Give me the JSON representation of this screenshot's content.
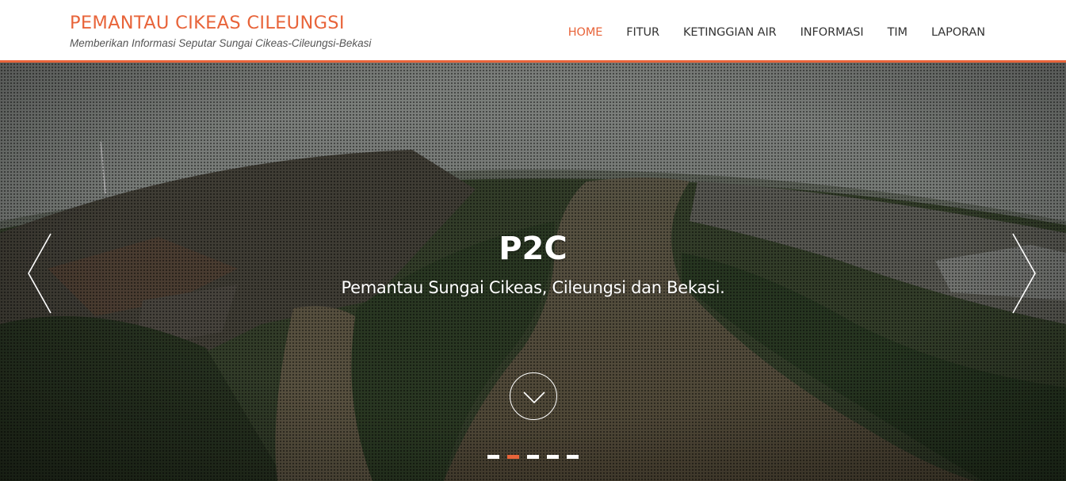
{
  "header": {
    "brand_title": "PEMANTAU CIKEAS CILEUNGSI",
    "brand_tagline": "Memberikan Informasi Seputar Sungai Cikeas-Cileungsi-Bekasi"
  },
  "nav": {
    "items": [
      {
        "label": "HOME",
        "active": true
      },
      {
        "label": "FITUR",
        "active": false
      },
      {
        "label": "KETINGGIAN AIR",
        "active": false
      },
      {
        "label": "INFORMASI",
        "active": false
      },
      {
        "label": "TIM",
        "active": false
      },
      {
        "label": "LAPORAN",
        "active": false
      }
    ]
  },
  "hero": {
    "title": "P2C",
    "subtitle": "Pemantau Sungai Cikeas, Cileungsi dan Bekasi.",
    "prev_icon": "chevron-left-icon",
    "next_icon": "chevron-right-icon",
    "scroll_icon": "chevron-down-icon",
    "slide_count": 5,
    "active_slide": 2
  },
  "colors": {
    "accent": "#e8643a",
    "nav_text": "#333333",
    "tagline": "#555555"
  }
}
